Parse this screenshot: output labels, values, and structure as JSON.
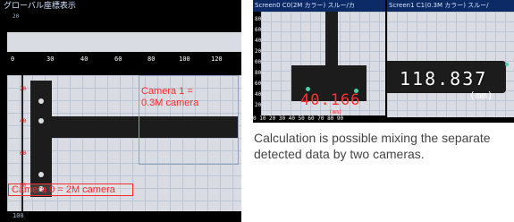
{
  "left_panel": {
    "title": "グローバル座標表示",
    "top_number": "20",
    "ruler_ticks": [
      "0",
      "30",
      "40",
      "60",
      "80",
      "100",
      "120"
    ],
    "vertical_ticks": [
      "20",
      "40",
      "60",
      "80"
    ],
    "bottom_number": "100",
    "camera1_label": "Camera 1 =\n0.3M camera",
    "camera0_label": "Camera 0 = 2M camera"
  },
  "right_panels": {
    "screen0_title": "Screen0 C0(2M カラー) スルー/カ",
    "screen1_title": "Screen1 C1(0.3M カラー) スルー/",
    "left_axis_ticks": [
      "80",
      "60",
      "40",
      "20",
      "00",
      "80",
      "60",
      "40",
      "20"
    ],
    "bottom_axis": "0 10 20 30 40 50 60 70 80 90",
    "measurement_left": "40.166",
    "unit_left": "(mm)",
    "measurement_right": "118.837",
    "unit_right": "(mm)"
  },
  "caption": "Calculation is possible mixing the separate detected data by two cameras.",
  "colors": {
    "annotation_red": "#ff2a2a",
    "title_bar_blue": "#0c2a66",
    "grid_background": "#d9dde3"
  }
}
